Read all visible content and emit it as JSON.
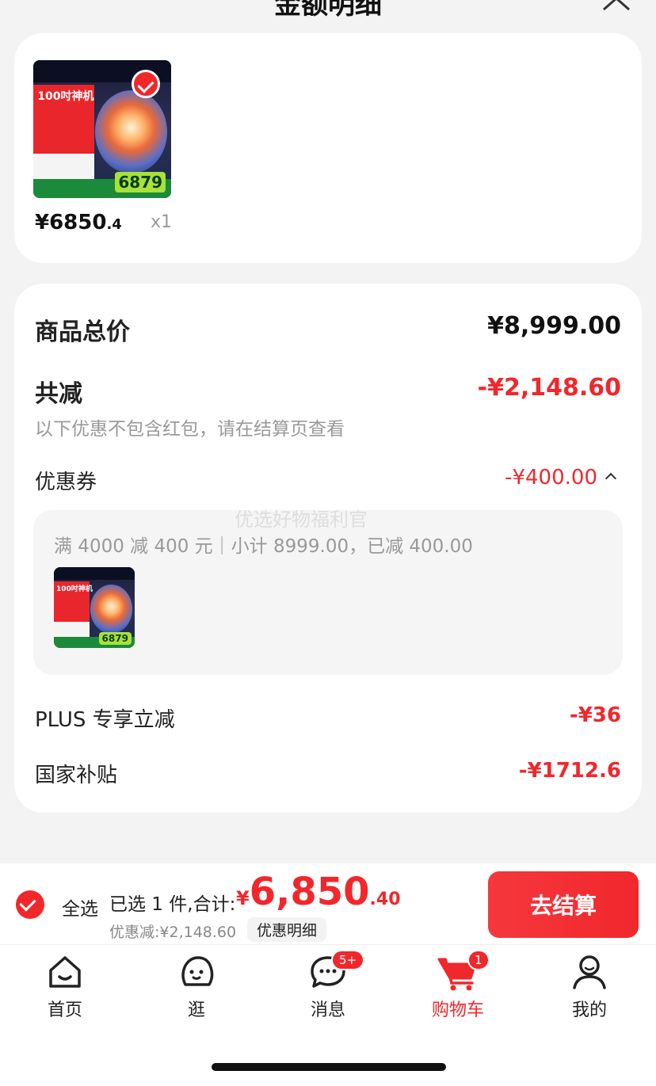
{
  "header": {
    "title": "金额明细"
  },
  "product": {
    "thumb_headline": "100吋神机",
    "thumb_price_tag": "6879",
    "price_int": "¥6850",
    "price_dec": ".4",
    "qty": "x1"
  },
  "summary": {
    "total_label": "商品总价",
    "total_value": "¥8,999.00",
    "reduce_label": "共减",
    "reduce_value": "-¥2,148.60",
    "note": "以下优惠不包含红包，请在结算页查看",
    "coupon_label": "优惠券",
    "coupon_value": "-¥400.00",
    "coupon_detail": "满 4000 减 400 元｜小计 8999.00，已减 400.00",
    "watermark": "优选好物福利官",
    "plus_label": "PLUS 专享立减",
    "plus_value": "-¥36",
    "subsidy_label": "国家补贴",
    "subsidy_value": "-¥1712.6"
  },
  "checkout": {
    "select_all": "全选",
    "selected_text": "已选 1 件,合计:",
    "currency": "¥",
    "total_int": "6,850",
    "total_dec": ".40",
    "discount_text": "优惠减:¥2,148.60",
    "detail_button": "优惠明细",
    "checkout_button": "去结算"
  },
  "tabs": [
    {
      "label": "首页",
      "icon": "home-icon"
    },
    {
      "label": "逛",
      "icon": "browse-icon"
    },
    {
      "label": "消息",
      "icon": "message-icon",
      "badge": "5+"
    },
    {
      "label": "购物车",
      "icon": "cart-icon",
      "badge": "1"
    },
    {
      "label": "我的",
      "icon": "profile-icon"
    }
  ],
  "colors": {
    "accent": "#f1272c",
    "background": "#f3f3f3"
  }
}
